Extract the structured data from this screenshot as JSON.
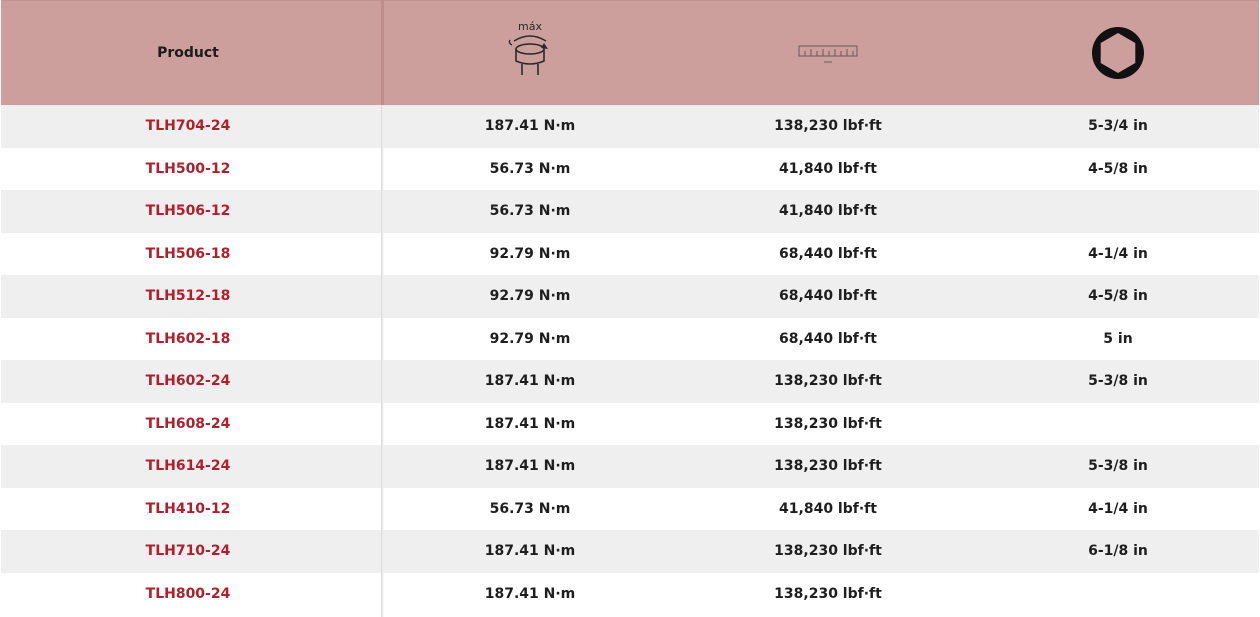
{
  "header": {
    "product_label": "Product",
    "torque_icon_text": "máx",
    "columns": [
      {
        "icon": "max-torque-icon"
      },
      {
        "icon": "ruler-scale-icon"
      },
      {
        "icon": "hex-socket-icon"
      }
    ]
  },
  "rows": [
    {
      "product": "TLH704-24",
      "torque_nm": "187.41 N·m",
      "torque_lbf": "138,230 lbf·ft",
      "hex": "5-3/4 in"
    },
    {
      "product": "TLH500-12",
      "torque_nm": "56.73 N·m",
      "torque_lbf": "41,840 lbf·ft",
      "hex": "4-5/8 in"
    },
    {
      "product": "TLH506-12",
      "torque_nm": "56.73 N·m",
      "torque_lbf": "41,840 lbf·ft",
      "hex": ""
    },
    {
      "product": "TLH506-18",
      "torque_nm": "92.79 N·m",
      "torque_lbf": "68,440 lbf·ft",
      "hex": "4-1/4 in"
    },
    {
      "product": "TLH512-18",
      "torque_nm": "92.79 N·m",
      "torque_lbf": "68,440 lbf·ft",
      "hex": "4-5/8 in"
    },
    {
      "product": "TLH602-18",
      "torque_nm": "92.79 N·m",
      "torque_lbf": "68,440 lbf·ft",
      "hex": "5 in"
    },
    {
      "product": "TLH602-24",
      "torque_nm": "187.41 N·m",
      "torque_lbf": "138,230 lbf·ft",
      "hex": "5-3/8 in"
    },
    {
      "product": "TLH608-24",
      "torque_nm": "187.41 N·m",
      "torque_lbf": "138,230 lbf·ft",
      "hex": ""
    },
    {
      "product": "TLH614-24",
      "torque_nm": "187.41 N·m",
      "torque_lbf": "138,230 lbf·ft",
      "hex": "5-3/8 in"
    },
    {
      "product": "TLH410-12",
      "torque_nm": "56.73 N·m",
      "torque_lbf": "41,840 lbf·ft",
      "hex": "4-1/4 in"
    },
    {
      "product": "TLH710-24",
      "torque_nm": "187.41 N·m",
      "torque_lbf": "138,230 lbf·ft",
      "hex": "6-1/8 in"
    },
    {
      "product": "TLH800-24",
      "torque_nm": "187.41 N·m",
      "torque_lbf": "138,230 lbf·ft",
      "hex": ""
    }
  ],
  "colors": {
    "header_bg": "#cc9f9c",
    "product_link": "#b0202c",
    "row_alt": "#efefef"
  }
}
